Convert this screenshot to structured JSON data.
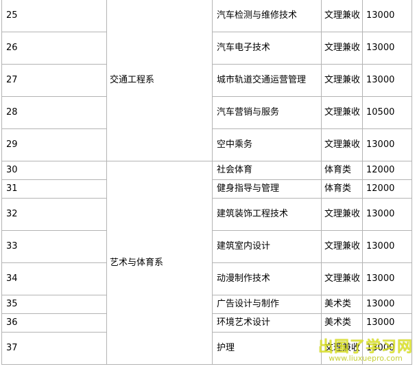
{
  "rows": [
    {
      "no": "25",
      "major": "汽车检测与维修技术",
      "type": "文理兼收",
      "fee": "13000"
    },
    {
      "no": "26",
      "major": "汽车电子技术",
      "type": "文理兼收",
      "fee": "13000"
    },
    {
      "no": "27",
      "major": "城市轨道交通运营管理",
      "type": "文理兼收",
      "fee": "13000"
    },
    {
      "no": "28",
      "major": "汽车营销与服务",
      "type": "文理兼收",
      "fee": "10500"
    },
    {
      "no": "29",
      "major": "空中乘务",
      "type": "文理兼收",
      "fee": "13000"
    },
    {
      "no": "30",
      "major": "社会体育",
      "type": "体育类",
      "fee": "12000"
    },
    {
      "no": "31",
      "major": "健身指导与管理",
      "type": "体育类",
      "fee": "12000"
    },
    {
      "no": "32",
      "major": "建筑装饰工程技术",
      "type": "文理兼收",
      "fee": "13000"
    },
    {
      "no": "33",
      "major": "建筑室内设计",
      "type": "文理兼收",
      "fee": "13000"
    },
    {
      "no": "34",
      "major": "动漫制作技术",
      "type": "文理兼收",
      "fee": "13000"
    },
    {
      "no": "35",
      "major": "广告设计与制作",
      "type": "美术类",
      "fee": "13000"
    },
    {
      "no": "36",
      "major": "环境艺术设计",
      "type": "美术类",
      "fee": "13000"
    },
    {
      "no": "37",
      "major": "护理",
      "type": "文理兼收",
      "fee": "13000"
    }
  ],
  "departments": {
    "transport": "交通工程系",
    "arts_sports": "艺术与体育系"
  },
  "watermark": {
    "main": "出国了学习网",
    "sub": "www.liuxuepro.com"
  }
}
